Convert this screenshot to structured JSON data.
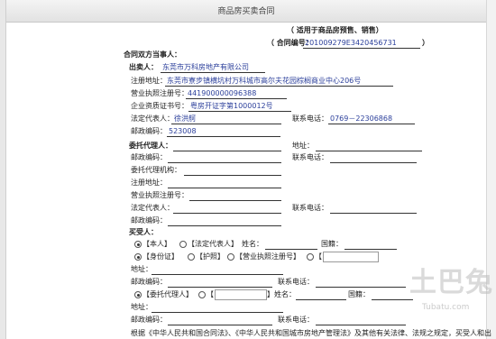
{
  "window": {
    "title": "商品房买卖合同"
  },
  "header": {
    "subtitle": "（ 适用于商品房预售、销售）",
    "contract_no_label": "（ 合同编号：",
    "contract_no": "201009279E3420456731",
    "contract_no_close": "）"
  },
  "parties": {
    "heading": "合同双方当事人："
  },
  "seller": {
    "label": "出卖人：",
    "name": "东莞市万科房地产有限公司",
    "address_label": "注册地址：",
    "address": "东莞市寮步镇横坑村万科城市高尔夫花园棕榈商业中心206号",
    "license_label": "营业执照注册号：",
    "license": "441900000096388",
    "qual_label": "企业资质证书号：",
    "qual": "粤房开证字第1000012号",
    "rep_label": "法定代表人：",
    "rep": "徐洪舸",
    "phone_label": "联系电话：",
    "phone": "0769－22306868",
    "zip_label": "邮政编码：",
    "zip": "523008"
  },
  "agent": {
    "label": "委托代理人：",
    "address_label": "地址：",
    "zip_label": "邮政编码：",
    "phone_label": "联系电话：",
    "agency_label": "委托代理机构：",
    "reg_address_label": "注册地址：",
    "license_label": "营业执照注册号：",
    "rep_label": "法定代表人：",
    "phone2_label": "联系电话：",
    "zip2_label": "邮政编码："
  },
  "buyer": {
    "label": "买受人：",
    "opt_self": "【本人】",
    "opt_rep": "【法定代表人】",
    "name_label": "姓名：",
    "nationality_label": "国籍：",
    "opt_id": "【身份证】",
    "opt_passport": "【护照】",
    "opt_license": "【营业执照注册号】",
    "opt_blank": "【",
    "address_label": "地址：",
    "zip_label": "邮政编码：",
    "phone_label": "联系电话：",
    "opt_agent": "【委托代理人】",
    "opt_bracket": "【",
    "name2_label": "】姓名：",
    "nationality2_label": "国籍：",
    "address2_label": "地址：",
    "zip2_label": "邮政编码：",
    "phone2_label": "联系电话："
  },
  "footer": {
    "text": "根据《中华人民共和国合同法》、《中华人民共和国城市房地产管理法》及其他有关法律、法规之规定，买受人和出"
  },
  "watermark": {
    "text": "土巴兔",
    "sub": "Tubatu.com"
  }
}
